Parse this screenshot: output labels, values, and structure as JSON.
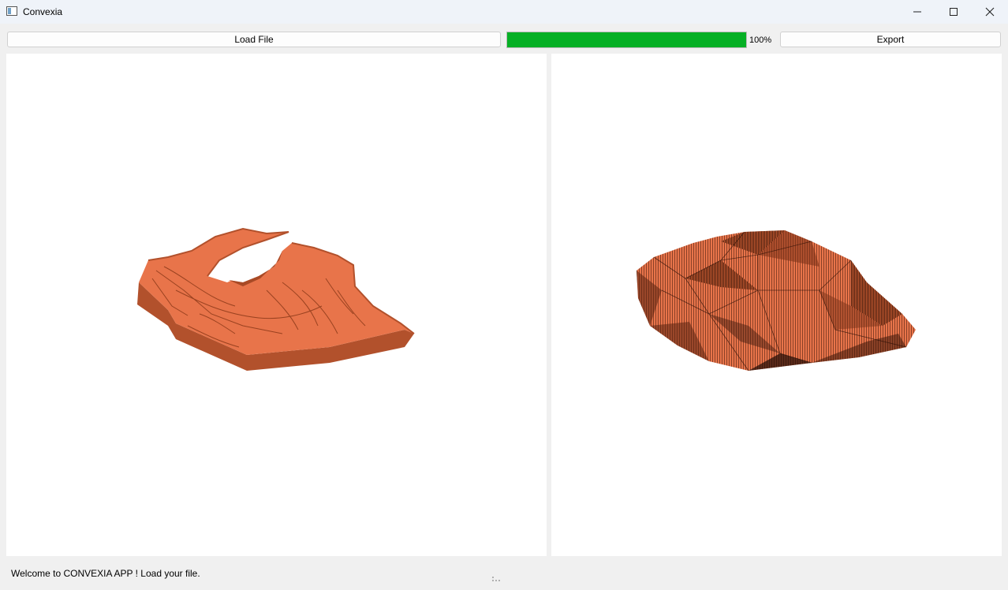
{
  "window": {
    "title": "Convexia",
    "app_icon": "window-app-icon",
    "controls": [
      "minimize-icon",
      "maximize-icon",
      "close-icon"
    ]
  },
  "toolbar": {
    "load_label": "Load File",
    "progress_value": 100,
    "progress_text": "100%",
    "export_label": "Export"
  },
  "viewports": {
    "left": {
      "content": "original mesh model",
      "color": "#e8744a"
    },
    "right": {
      "content": "convex hull mesh",
      "color": "#e8744a"
    }
  },
  "status": {
    "message": "Welcome to CONVEXIA APP ! Load your file."
  },
  "colors": {
    "progress_fill": "#06b025",
    "mesh": "#e8744a",
    "background": "#f0f0f0"
  }
}
